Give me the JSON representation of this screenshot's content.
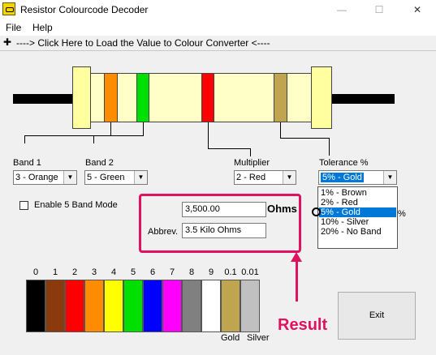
{
  "window": {
    "title": "Resistor Colourcode Decoder",
    "min_glyph": "—",
    "max_glyph": "☐",
    "close_glyph": "✕"
  },
  "menu": {
    "file": "File",
    "help": "Help"
  },
  "loader": {
    "plus": "✚",
    "text": "----> Click Here to Load the Value to Colour Converter <----"
  },
  "bands": {
    "band1": {
      "label": "Band 1",
      "value": "3 - Orange",
      "color": "#ff8c00"
    },
    "band2": {
      "label": "Band 2",
      "value": "5 - Green",
      "color": "#00e000"
    },
    "multiplier": {
      "label": "Multiplier",
      "value": "2 - Red",
      "color": "#ff0000"
    },
    "tolerance": {
      "label": "Tolerance %",
      "value": "5% - Gold",
      "color": "#bfa550",
      "options": [
        "1% - Brown",
        "2% - Red",
        "5% - Gold",
        "10% - Silver",
        "20% - No Band"
      ],
      "selected_index": 2
    }
  },
  "five_band": {
    "label": "Enable 5 Band Mode",
    "checked": false
  },
  "result": {
    "value": "3,500.00",
    "unit": "Ohms",
    "abbrev_label": "Abbrev.",
    "abbrev_value": "3.5 Kilo Ohms",
    "hidden_suffix": "%",
    "annotation": "Result",
    "annotation_color": "#e0115f"
  },
  "palette": {
    "ticks": [
      "0",
      "1",
      "2",
      "3",
      "4",
      "5",
      "6",
      "7",
      "8",
      "9",
      "0.1",
      "0.01"
    ],
    "colors": [
      "#000000",
      "#8b3a0e",
      "#ff0000",
      "#ff8c00",
      "#ffff00",
      "#00e000",
      "#0000ff",
      "#ff00ff",
      "#808080",
      "#ffffff",
      "#bfa550",
      "#c0c0c0"
    ],
    "gold_label": "Gold",
    "silver_label": "Silver"
  },
  "exit_button": "Exit"
}
